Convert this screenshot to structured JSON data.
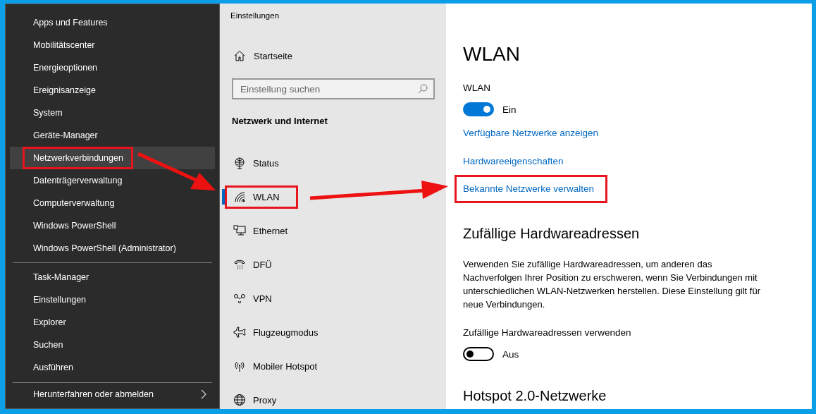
{
  "context_menu": {
    "groups": [
      [
        {
          "label": "Apps und Features",
          "hovered": false,
          "highlighted": false,
          "submenu": false
        },
        {
          "label": "Mobilitätscenter",
          "hovered": false,
          "highlighted": false,
          "submenu": false
        },
        {
          "label": "Energieoptionen",
          "hovered": false,
          "highlighted": false,
          "submenu": false
        },
        {
          "label": "Ereignisanzeige",
          "hovered": false,
          "highlighted": false,
          "submenu": false
        },
        {
          "label": "System",
          "hovered": false,
          "highlighted": false,
          "submenu": false
        },
        {
          "label": "Geräte-Manager",
          "hovered": false,
          "highlighted": false,
          "submenu": false
        },
        {
          "label": "Netzwerkverbindungen",
          "hovered": true,
          "highlighted": true,
          "submenu": false
        },
        {
          "label": "Datenträgerverwaltung",
          "hovered": false,
          "highlighted": false,
          "submenu": false
        },
        {
          "label": "Computerverwaltung",
          "hovered": false,
          "highlighted": false,
          "submenu": false
        },
        {
          "label": "Windows PowerShell",
          "hovered": false,
          "highlighted": false,
          "submenu": false
        },
        {
          "label": "Windows PowerShell (Administrator)",
          "hovered": false,
          "highlighted": false,
          "submenu": false
        }
      ],
      [
        {
          "label": "Task-Manager",
          "hovered": false,
          "highlighted": false,
          "submenu": false
        },
        {
          "label": "Einstellungen",
          "hovered": false,
          "highlighted": false,
          "submenu": false
        },
        {
          "label": "Explorer",
          "hovered": false,
          "highlighted": false,
          "submenu": false
        },
        {
          "label": "Suchen",
          "hovered": false,
          "highlighted": false,
          "submenu": false
        },
        {
          "label": "Ausführen",
          "hovered": false,
          "highlighted": false,
          "submenu": false
        }
      ],
      [
        {
          "label": "Herunterfahren oder abmelden",
          "hovered": false,
          "highlighted": false,
          "submenu": true
        }
      ]
    ]
  },
  "settings": {
    "title": "Einstellungen",
    "home": "Startseite",
    "search": {
      "placeholder": "Einstellung suchen"
    },
    "section": "Netzwerk und Internet",
    "nav": [
      {
        "label": "Status",
        "selected": false,
        "highlighted": false
      },
      {
        "label": "WLAN",
        "selected": true,
        "highlighted": true
      },
      {
        "label": "Ethernet",
        "selected": false,
        "highlighted": false
      },
      {
        "label": "DFÜ",
        "selected": false,
        "highlighted": false
      },
      {
        "label": "VPN",
        "selected": false,
        "highlighted": false
      },
      {
        "label": "Flugzeugmodus",
        "selected": false,
        "highlighted": false
      },
      {
        "label": "Mobiler Hotspot",
        "selected": false,
        "highlighted": false
      },
      {
        "label": "Proxy",
        "selected": false,
        "highlighted": false
      }
    ]
  },
  "page": {
    "title": "WLAN",
    "wlan": {
      "label": "WLAN",
      "on": true,
      "state": "Ein"
    },
    "links": [
      {
        "label": "Verfügbare Netzwerke anzeigen",
        "highlighted": false
      },
      {
        "label": "Hardwareeigenschaften",
        "highlighted": false
      },
      {
        "label": "Bekannte Netzwerke verwalten",
        "highlighted": true
      }
    ],
    "random": {
      "heading": "Zufällige Hardwareadressen",
      "description": "Verwenden Sie zufällige Hardwareadressen, um anderen das Nachverfolgen Ihrer Position zu erschweren, wenn Sie Verbindungen mit unterschiedlichen WLAN-Netzwerken herstellen. Diese Einstellung gilt für neue Verbindungen.",
      "label": "Zufällige Hardwareadressen verwenden",
      "on": false,
      "state": "Aus"
    },
    "hotspot_heading": "Hotspot 2.0-Netzwerke"
  }
}
